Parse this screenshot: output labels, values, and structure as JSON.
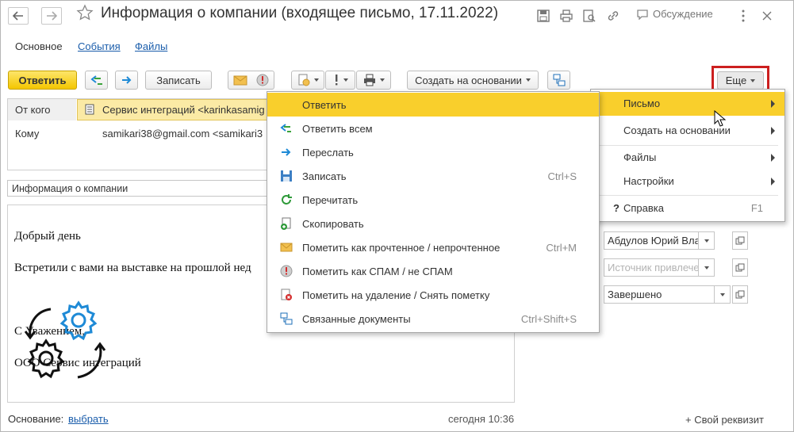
{
  "window": {
    "title": "Информация о компании (входящее письмо, 17.11.2022)",
    "discussion_label": "Обсуждение"
  },
  "tabs": [
    {
      "label": "Основное"
    },
    {
      "label": "События"
    },
    {
      "label": "Файлы"
    }
  ],
  "toolbar": {
    "reply_label": "Ответить",
    "save_label": "Записать",
    "create_based_label": "Создать на основании",
    "more_label": "Еще"
  },
  "form": {
    "from_label": "От кого",
    "from_value": "Сервис интеграций <karinkasamig",
    "to_label": "Кому",
    "to_value": "samikari38@gmail.com <samikari3",
    "subject_value": "Информация о компании",
    "body_lines": [
      "Добрый день",
      "Встретили с вами на выставке на прошлой нед",
      "",
      "С Уважением,",
      "ООО Сервис интеграций"
    ],
    "responsible_value": "Абдулов Юрий Влади",
    "source_placeholder": "Источник привлечен...",
    "status_value": "Завершено",
    "basis_label": "Основание:",
    "basis_link": "выбрать",
    "timestamp": "сегодня 10:36",
    "custom_attr_label": "+ Свой реквизит"
  },
  "more_menu": {
    "items": [
      {
        "label": "Письмо",
        "submenu": true
      },
      {
        "label": "Создать на основании",
        "submenu": true
      },
      {
        "label": "Файлы",
        "submenu": true
      },
      {
        "label": "Настройки",
        "submenu": true
      },
      {
        "label": "Справка",
        "shortcut": "F1",
        "icon": "?"
      }
    ]
  },
  "letter_menu": {
    "items": [
      {
        "label": "Ответить",
        "shortcut": "",
        "icon": "none"
      },
      {
        "label": "Ответить всем",
        "shortcut": "",
        "icon": "reply-all-icon"
      },
      {
        "label": "Переслать",
        "shortcut": "",
        "icon": "forward-icon"
      },
      {
        "label": "Записать",
        "shortcut": "Ctrl+S",
        "icon": "save-icon"
      },
      {
        "label": "Перечитать",
        "shortcut": "",
        "icon": "refresh-icon"
      },
      {
        "label": "Скопировать",
        "shortcut": "",
        "icon": "copy-icon"
      },
      {
        "label": "Пометить как прочтенное / непрочтенное",
        "shortcut": "Ctrl+M",
        "icon": "envelope-icon"
      },
      {
        "label": "Пометить как СПАМ / не СПАМ",
        "shortcut": "",
        "icon": "spam-icon"
      },
      {
        "label": "Пометить на удаление / Снять пометку",
        "shortcut": "",
        "icon": "delete-mark-icon"
      },
      {
        "label": "Связанные документы",
        "shortcut": "Ctrl+Shift+S",
        "icon": "linked-docs-icon"
      }
    ]
  },
  "colors": {
    "accent_yellow": "#f9cf2c",
    "link_blue": "#1a5dab",
    "icon_blue": "#1e8ad6",
    "highlight_red": "#cc1f1f"
  }
}
